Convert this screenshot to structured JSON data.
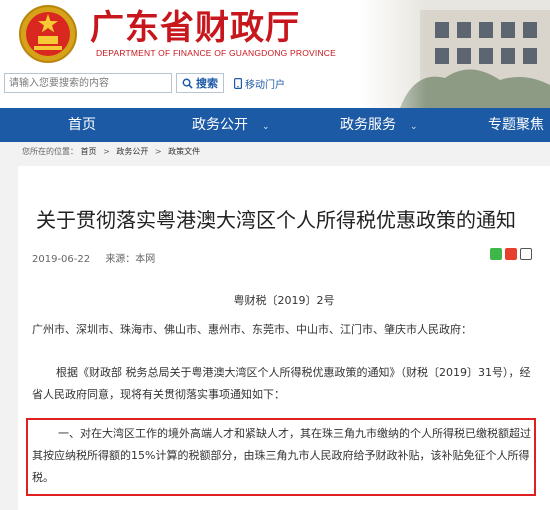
{
  "header": {
    "site_title": "广东省财政厅",
    "site_subtitle": "DEPARTMENT OF FINANCE OF GUANGDONG PROVINCE",
    "search_placeholder": "请输入您要搜索的内容",
    "search_button": "搜索",
    "mobile_portal": "移动门户"
  },
  "nav": {
    "items": [
      {
        "label": "首页"
      },
      {
        "label": "政务公开"
      },
      {
        "label": "政务服务"
      },
      {
        "label": "专题聚焦"
      }
    ]
  },
  "breadcrumb": {
    "prefix": "您所在的位置：",
    "items": [
      "首页",
      "政务公开",
      "政策文件"
    ]
  },
  "article": {
    "title": "关于贯彻落实粤港澳大湾区个人所得税优惠政策的通知",
    "date": "2019-06-22",
    "source": "来源：本网",
    "doc_number": "粤财税〔2019〕2号",
    "recipient": "广州市、深圳市、珠海市、佛山市、惠州市、东莞市、中山市、江门市、肇庆市人民政府：",
    "intro": "根据《财政部 税务总局关于粤港澳大湾区个人所得税优惠政策的通知》（财税〔2019〕31号），经省人民政府同意，现将有关贯彻落实事项通知如下：",
    "item_1": "一、对在大湾区工作的境外高端人才和紧缺人才，其在珠三角九市缴纳的个人所得税已缴税额超过其按应纳税所得额的15%计算的税额部分，由珠三角九市人民政府给予财政补贴，该补贴免征个人所得税。"
  },
  "colors": {
    "brand_red": "#c8161d",
    "nav_blue": "#1c5aa5",
    "highlight_red": "#e02020"
  },
  "icons": [
    "national-emblem-icon",
    "search-icon",
    "mobile-icon",
    "wechat-share-icon",
    "weibo-share-icon",
    "print-icon"
  ]
}
